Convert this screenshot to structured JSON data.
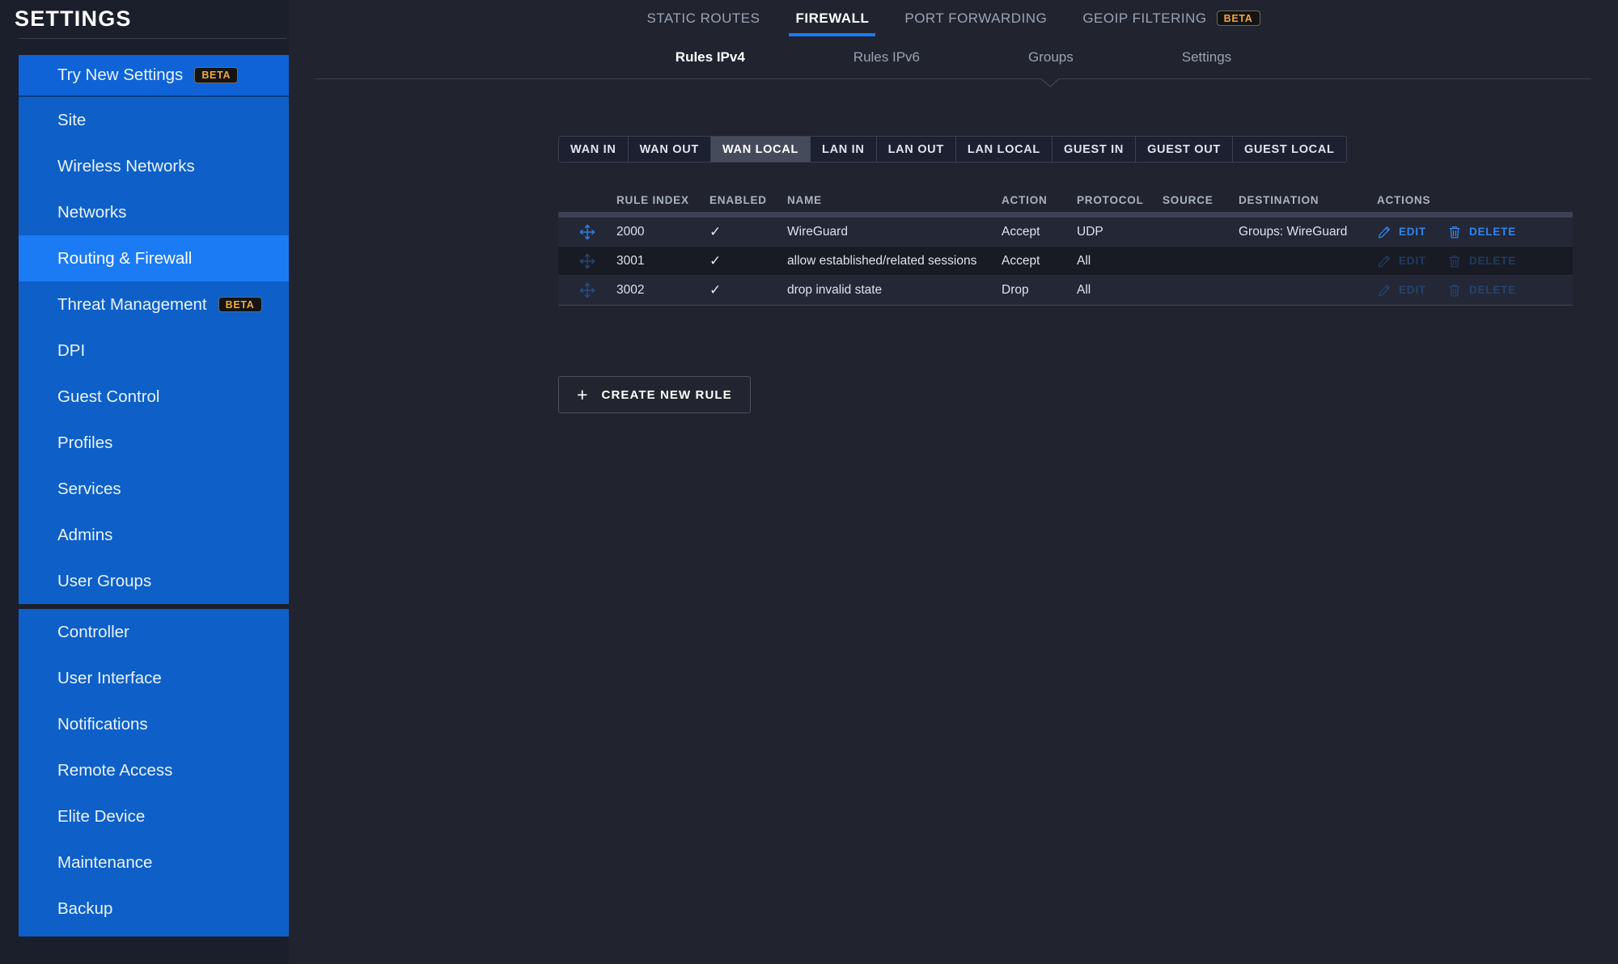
{
  "sidebar": {
    "title": "SETTINGS",
    "beta_label": "BETA",
    "group1": [
      {
        "label": "Try New Settings",
        "beta": true
      },
      {
        "label": "Site",
        "beta": false
      },
      {
        "label": "Wireless Networks",
        "beta": false
      },
      {
        "label": "Networks",
        "beta": false
      },
      {
        "label": "Routing & Firewall",
        "beta": false
      },
      {
        "label": "Threat Management",
        "beta": true
      },
      {
        "label": "DPI",
        "beta": false
      },
      {
        "label": "Guest Control",
        "beta": false
      },
      {
        "label": "Profiles",
        "beta": false
      },
      {
        "label": "Services",
        "beta": false
      },
      {
        "label": "Admins",
        "beta": false
      },
      {
        "label": "User Groups",
        "beta": false
      }
    ],
    "group2": [
      {
        "label": "Controller"
      },
      {
        "label": "User Interface"
      },
      {
        "label": "Notifications"
      },
      {
        "label": "Remote Access"
      },
      {
        "label": "Elite Device"
      },
      {
        "label": "Maintenance"
      },
      {
        "label": "Backup"
      }
    ]
  },
  "topnav": [
    {
      "label": "STATIC ROUTES",
      "active": false,
      "beta": false
    },
    {
      "label": "FIREWALL",
      "active": true,
      "beta": false
    },
    {
      "label": "PORT FORWARDING",
      "active": false,
      "beta": false
    },
    {
      "label": "GEOIP FILTERING",
      "active": false,
      "beta": true
    }
  ],
  "subnav": [
    {
      "label": "Rules IPv4",
      "active": true
    },
    {
      "label": "Rules IPv6",
      "active": false
    },
    {
      "label": "Groups",
      "active": false
    },
    {
      "label": "Settings",
      "active": false
    }
  ],
  "direction_tabs": [
    {
      "label": "WAN IN",
      "active": false
    },
    {
      "label": "WAN OUT",
      "active": false
    },
    {
      "label": "WAN LOCAL",
      "active": true
    },
    {
      "label": "LAN IN",
      "active": false
    },
    {
      "label": "LAN OUT",
      "active": false
    },
    {
      "label": "LAN LOCAL",
      "active": false
    },
    {
      "label": "GUEST IN",
      "active": false
    },
    {
      "label": "GUEST OUT",
      "active": false
    },
    {
      "label": "GUEST LOCAL",
      "active": false
    }
  ],
  "table": {
    "headers": {
      "rule_index": "RULE INDEX",
      "enabled": "ENABLED",
      "name": "NAME",
      "action": "ACTION",
      "protocol": "PROTOCOL",
      "source": "SOURCE",
      "destination": "DESTINATION",
      "actions": "ACTIONS"
    },
    "edit_label": "EDIT",
    "delete_label": "DELETE",
    "enabled_mark": "✓",
    "rows": [
      {
        "rule_index": "2000",
        "enabled": "✓",
        "name": "WireGuard",
        "action": "Accept",
        "protocol": "UDP",
        "source": "",
        "destination": "Groups:  WireGuard",
        "dimmed": false
      },
      {
        "rule_index": "3001",
        "enabled": "✓",
        "name": "allow established/related sessions",
        "action": "Accept",
        "protocol": "All",
        "source": "",
        "destination": "",
        "dimmed": true
      },
      {
        "rule_index": "3002",
        "enabled": "✓",
        "name": "drop invalid state",
        "action": "Drop",
        "protocol": "All",
        "source": "",
        "destination": "",
        "dimmed": true
      }
    ]
  },
  "create_button": {
    "plus": "+",
    "label": "CREATE NEW RULE"
  },
  "colors": {
    "accent_blue": "#1a7bf5",
    "sidebar_blue": "#0e5fc8",
    "beta_orange": "#f2a93b",
    "link_blue": "#2f86f0",
    "background": "#21242f",
    "sidebar_bg": "#1b1e2b"
  }
}
